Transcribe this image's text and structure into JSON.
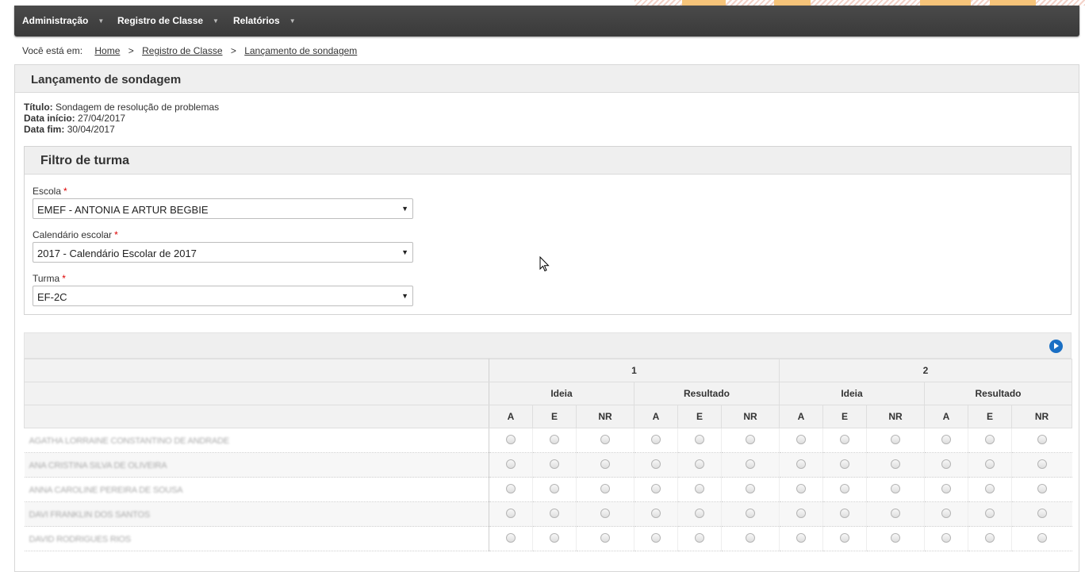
{
  "menu": [
    {
      "label": "Administração"
    },
    {
      "label": "Registro de Classe"
    },
    {
      "label": "Relatórios"
    }
  ],
  "breadcrumb": {
    "prefix": "Você está em:",
    "items": [
      "Home",
      "Registro de Classe",
      "Lançamento de sondagem"
    ],
    "separator": ">"
  },
  "page": {
    "title": "Lançamento de sondagem",
    "info": [
      {
        "label": "Título:",
        "value": "Sondagem de resolução de problemas"
      },
      {
        "label": "Data início:",
        "value": "27/04/2017"
      },
      {
        "label": "Data fim:",
        "value": "30/04/2017"
      }
    ]
  },
  "filter": {
    "title": "Filtro de turma",
    "fields": [
      {
        "label": "Escola",
        "value": "EMEF - ANTONIA E ARTUR BEGBIE"
      },
      {
        "label": "Calendário escolar",
        "value": "2017 - Calendário Escolar de 2017"
      },
      {
        "label": "Turma",
        "value": "EF-2C"
      }
    ],
    "required_mark": "*"
  },
  "grid": {
    "groups": [
      "1",
      "2"
    ],
    "subgroups": [
      "Ideia",
      "Resultado",
      "Ideia",
      "Resultado"
    ],
    "options": [
      "A",
      "E",
      "NR",
      "A",
      "E",
      "NR",
      "A",
      "E",
      "NR",
      "A",
      "E",
      "NR"
    ],
    "students": [
      "AGATHA LORRAINE CONSTANTINO DE ANDRADE",
      "ANA CRISTINA SILVA DE OLIVEIRA",
      "ANNA CAROLINE PEREIRA DE SOUSA",
      "DAVI FRANKLIN DOS SANTOS",
      "DAVID RODRIGUES RIOS"
    ]
  },
  "colors": {
    "menubar": "#404040",
    "header_bg": "#efefef",
    "accent": "#1a6fc4",
    "required": "#dd0000"
  }
}
